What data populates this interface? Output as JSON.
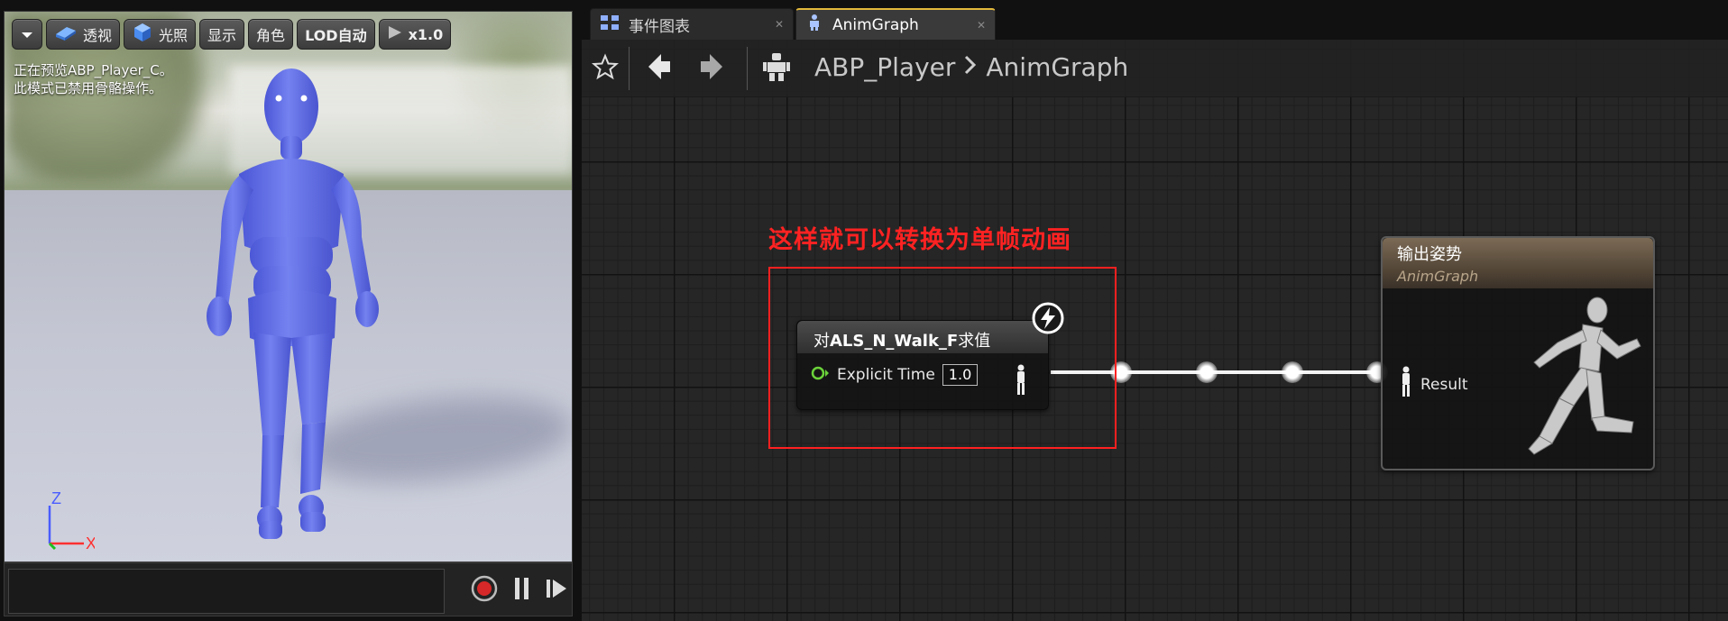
{
  "viewport": {
    "toolbar": {
      "perspective_label": "透视",
      "lighting_label": "光照",
      "show_label": "显示",
      "character_label": "角色",
      "lod_label": "LOD自动",
      "speed_label": "x1.0"
    },
    "info_line1": "正在预览ABP_Player_C。",
    "info_line2": "此模式已禁用骨骼操作。",
    "axis": {
      "z": "Z",
      "x": "X"
    }
  },
  "tabs": [
    {
      "label": "事件图表",
      "active": false
    },
    {
      "label": "AnimGraph",
      "active": true
    }
  ],
  "graph": {
    "breadcrumb": {
      "root": "ABP_Player",
      "current": "AnimGraph"
    },
    "annotation": "这样就可以转换为单帧动画",
    "eval_node": {
      "title_prefix": "对",
      "title_bold": "ALS_N_Walk_F",
      "title_suffix": "求值",
      "pin_label": "Explicit Time",
      "pin_value": "1.0"
    },
    "output_node": {
      "title": "输出姿势",
      "subtitle": "AnimGraph",
      "pin_label": "Result"
    }
  },
  "colors": {
    "accent_tab": "#e2b93b",
    "annotation_red": "#ff2222",
    "mannequin_blue": "#6470e6",
    "pin_green": "#6bd23a"
  }
}
